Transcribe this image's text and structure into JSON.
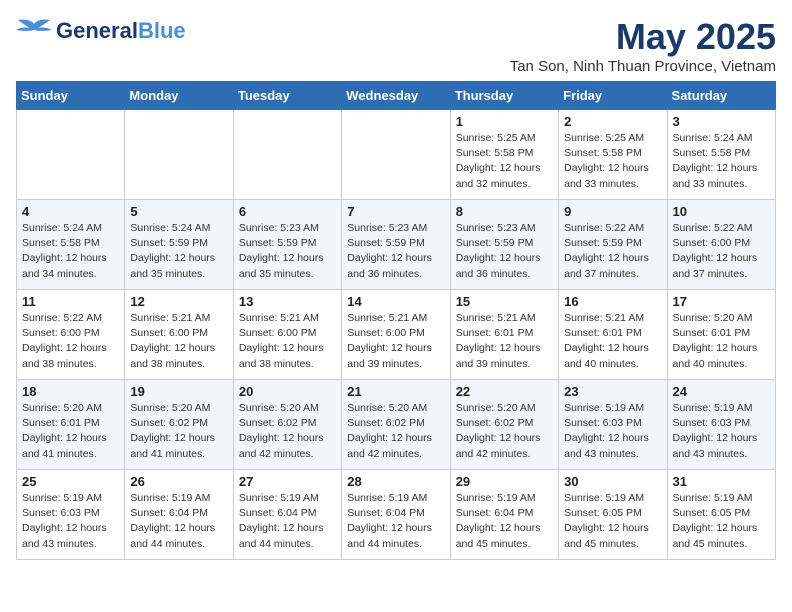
{
  "header": {
    "logo_general": "General",
    "logo_blue": "Blue",
    "main_title": "May 2025",
    "sub_title": "Tan Son, Ninh Thuan Province, Vietnam"
  },
  "days_of_week": [
    "Sunday",
    "Monday",
    "Tuesday",
    "Wednesday",
    "Thursday",
    "Friday",
    "Saturday"
  ],
  "weeks": [
    [
      {
        "day": "",
        "info": ""
      },
      {
        "day": "",
        "info": ""
      },
      {
        "day": "",
        "info": ""
      },
      {
        "day": "",
        "info": ""
      },
      {
        "day": "1",
        "info": "Sunrise: 5:25 AM\nSunset: 5:58 PM\nDaylight: 12 hours\nand 32 minutes."
      },
      {
        "day": "2",
        "info": "Sunrise: 5:25 AM\nSunset: 5:58 PM\nDaylight: 12 hours\nand 33 minutes."
      },
      {
        "day": "3",
        "info": "Sunrise: 5:24 AM\nSunset: 5:58 PM\nDaylight: 12 hours\nand 33 minutes."
      }
    ],
    [
      {
        "day": "4",
        "info": "Sunrise: 5:24 AM\nSunset: 5:58 PM\nDaylight: 12 hours\nand 34 minutes."
      },
      {
        "day": "5",
        "info": "Sunrise: 5:24 AM\nSunset: 5:59 PM\nDaylight: 12 hours\nand 35 minutes."
      },
      {
        "day": "6",
        "info": "Sunrise: 5:23 AM\nSunset: 5:59 PM\nDaylight: 12 hours\nand 35 minutes."
      },
      {
        "day": "7",
        "info": "Sunrise: 5:23 AM\nSunset: 5:59 PM\nDaylight: 12 hours\nand 36 minutes."
      },
      {
        "day": "8",
        "info": "Sunrise: 5:23 AM\nSunset: 5:59 PM\nDaylight: 12 hours\nand 36 minutes."
      },
      {
        "day": "9",
        "info": "Sunrise: 5:22 AM\nSunset: 5:59 PM\nDaylight: 12 hours\nand 37 minutes."
      },
      {
        "day": "10",
        "info": "Sunrise: 5:22 AM\nSunset: 6:00 PM\nDaylight: 12 hours\nand 37 minutes."
      }
    ],
    [
      {
        "day": "11",
        "info": "Sunrise: 5:22 AM\nSunset: 6:00 PM\nDaylight: 12 hours\nand 38 minutes."
      },
      {
        "day": "12",
        "info": "Sunrise: 5:21 AM\nSunset: 6:00 PM\nDaylight: 12 hours\nand 38 minutes."
      },
      {
        "day": "13",
        "info": "Sunrise: 5:21 AM\nSunset: 6:00 PM\nDaylight: 12 hours\nand 38 minutes."
      },
      {
        "day": "14",
        "info": "Sunrise: 5:21 AM\nSunset: 6:00 PM\nDaylight: 12 hours\nand 39 minutes."
      },
      {
        "day": "15",
        "info": "Sunrise: 5:21 AM\nSunset: 6:01 PM\nDaylight: 12 hours\nand 39 minutes."
      },
      {
        "day": "16",
        "info": "Sunrise: 5:21 AM\nSunset: 6:01 PM\nDaylight: 12 hours\nand 40 minutes."
      },
      {
        "day": "17",
        "info": "Sunrise: 5:20 AM\nSunset: 6:01 PM\nDaylight: 12 hours\nand 40 minutes."
      }
    ],
    [
      {
        "day": "18",
        "info": "Sunrise: 5:20 AM\nSunset: 6:01 PM\nDaylight: 12 hours\nand 41 minutes."
      },
      {
        "day": "19",
        "info": "Sunrise: 5:20 AM\nSunset: 6:02 PM\nDaylight: 12 hours\nand 41 minutes."
      },
      {
        "day": "20",
        "info": "Sunrise: 5:20 AM\nSunset: 6:02 PM\nDaylight: 12 hours\nand 42 minutes."
      },
      {
        "day": "21",
        "info": "Sunrise: 5:20 AM\nSunset: 6:02 PM\nDaylight: 12 hours\nand 42 minutes."
      },
      {
        "day": "22",
        "info": "Sunrise: 5:20 AM\nSunset: 6:02 PM\nDaylight: 12 hours\nand 42 minutes."
      },
      {
        "day": "23",
        "info": "Sunrise: 5:19 AM\nSunset: 6:03 PM\nDaylight: 12 hours\nand 43 minutes."
      },
      {
        "day": "24",
        "info": "Sunrise: 5:19 AM\nSunset: 6:03 PM\nDaylight: 12 hours\nand 43 minutes."
      }
    ],
    [
      {
        "day": "25",
        "info": "Sunrise: 5:19 AM\nSunset: 6:03 PM\nDaylight: 12 hours\nand 43 minutes."
      },
      {
        "day": "26",
        "info": "Sunrise: 5:19 AM\nSunset: 6:04 PM\nDaylight: 12 hours\nand 44 minutes."
      },
      {
        "day": "27",
        "info": "Sunrise: 5:19 AM\nSunset: 6:04 PM\nDaylight: 12 hours\nand 44 minutes."
      },
      {
        "day": "28",
        "info": "Sunrise: 5:19 AM\nSunset: 6:04 PM\nDaylight: 12 hours\nand 44 minutes."
      },
      {
        "day": "29",
        "info": "Sunrise: 5:19 AM\nSunset: 6:04 PM\nDaylight: 12 hours\nand 45 minutes."
      },
      {
        "day": "30",
        "info": "Sunrise: 5:19 AM\nSunset: 6:05 PM\nDaylight: 12 hours\nand 45 minutes."
      },
      {
        "day": "31",
        "info": "Sunrise: 5:19 AM\nSunset: 6:05 PM\nDaylight: 12 hours\nand 45 minutes."
      }
    ]
  ]
}
